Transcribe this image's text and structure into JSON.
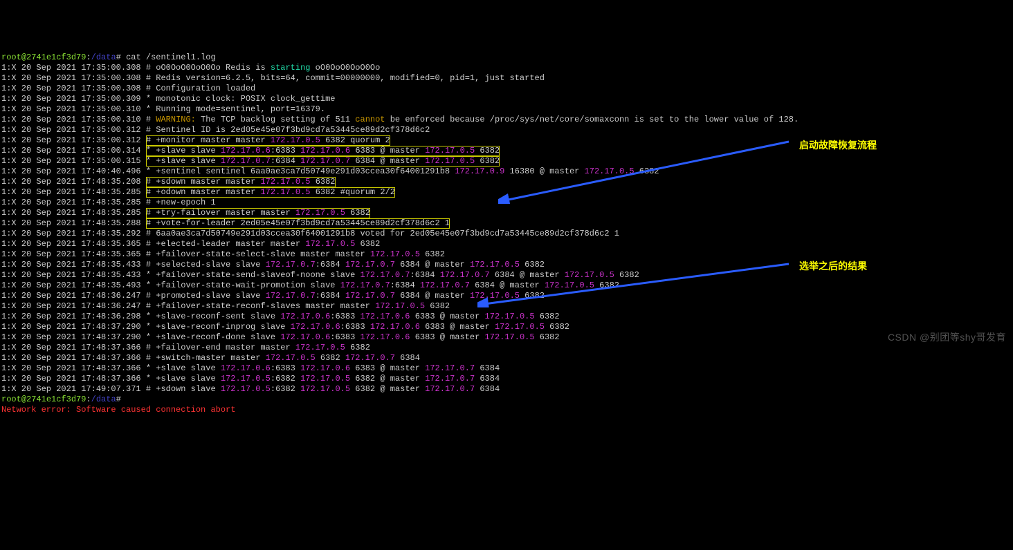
{
  "prompt": {
    "user": "root",
    "host": "2741e1cf3d79",
    "cwd": "/data",
    "sym": "#",
    "cmd": "cat /sentinel1.log"
  },
  "lines": {
    "l01a": "1:X 20 Sep 2021 17:35:00.308 # oO0OoO0OoO0Oo Redis is ",
    "l01b": "starting",
    "l01c": " oO0OoO0OoO0Oo",
    "l02": "1:X 20 Sep 2021 17:35:00.308 # Redis version=6.2.5, bits=64, commit=00000000, modified=0, pid=1, just started",
    "l03": "1:X 20 Sep 2021 17:35:00.308 # Configuration loaded",
    "l04": "1:X 20 Sep 2021 17:35:00.309 * monotonic clock: POSIX clock_gettime",
    "l05": "1:X 20 Sep 2021 17:35:00.310 * Running mode=sentinel, port=16379.",
    "l06a": "1:X 20 Sep 2021 17:35:00.310 # ",
    "l06b": "WARNING:",
    "l06c": " The TCP backlog setting of 511 ",
    "l06d": "cannot",
    "l06e": " be enforced because /proc/sys/net/core/somaxconn is set to the lower value of 128.",
    "l07": "1:X 20 Sep 2021 17:35:00.312 # Sentinel ID is 2ed05e45e07f3bd9cd7a53445ce89d2cf378d6c2",
    "l08a": "1:X 20 Sep 2021 17:35:00.312 ",
    "l08b": "# +monitor master master ",
    "l08ip": "172.17.0.5",
    "l08c": " 6382 quorum 2",
    "l09a": "1:X 20 Sep 2021 17:35:00.314 ",
    "l09b": "* +slave slave ",
    "l09ip1": "172.17.0.6",
    "l09c": ":6383 ",
    "l09ip2": "172.17.0.6",
    "l09d": " 6383 @ master ",
    "l09ip3": "172.17.0.5",
    "l09e": " 6382",
    "l10a": "1:X 20 Sep 2021 17:35:00.315 ",
    "l10b": "* +slave slave ",
    "l10ip1": "172.17.0.7",
    "l10c": ":6384 ",
    "l10ip2": "172.17.0.7",
    "l10d": " 6384 @ master ",
    "l10ip3": "172.17.0.5",
    "l10e": " 6382",
    "l11a": "1:X 20 Sep 2021 17:40:40.496 * +sentinel sentinel 6aa0ae3ca7d50749e291d03ccea30f64001291b8 ",
    "l11ip1": "172.17.0.9",
    "l11b": " 16380 @ master ",
    "l11ip2": "172.17.0.5",
    "l11c": " 6382",
    "l12a": "1:X 20 Sep 2021 17:48:35.208 ",
    "l12b": "# +sdown master master ",
    "l12ip": "172.17.0.5",
    "l12c": " 6382",
    "l13a": "1:X 20 Sep 2021 17:48:35.285 ",
    "l13b": "# +odown master master ",
    "l13ip": "172.17.0.5",
    "l13c": " 6382 #quorum 2/2",
    "l14": "1:X 20 Sep 2021 17:48:35.285 # +new-epoch 1",
    "l15a": "1:X 20 Sep 2021 17:48:35.285 ",
    "l15b": "# +try-failover master master ",
    "l15ip": "172.17.0.5",
    "l15c": " 6382",
    "l16a": "1:X 20 Sep 2021 17:48:35.288 ",
    "l16b": "# +vote-for-leader 2ed05e45e07f3bd9cd7a53445ce89d2cf378d6c2 1",
    "l17": "1:X 20 Sep 2021 17:48:35.292 # 6aa0ae3ca7d50749e291d03ccea30f64001291b8 voted for 2ed05e45e07f3bd9cd7a53445ce89d2cf378d6c2 1",
    "l18a": "1:X 20 Sep 2021 17:48:35.365 # +elected-leader master master ",
    "l18ip": "172.17.0.5",
    "l18b": " 6382",
    "l19a": "1:X 20 Sep 2021 17:48:35.365 # +failover-state-select-slave master master ",
    "l19ip": "172.17.0.5",
    "l19b": " 6382",
    "l20a": "1:X 20 Sep 2021 17:48:35.433 # +selected-slave slave ",
    "l20ip1": "172.17.0.7",
    "l20b": ":6384 ",
    "l20ip2": "172.17.0.7",
    "l20c": " 6384 @ master ",
    "l20ip3": "172.17.0.5",
    "l20d": " 6382",
    "l21a": "1:X 20 Sep 2021 17:48:35.433 * +failover-state-send-slaveof-noone slave ",
    "l21ip1": "172.17.0.7",
    "l21b": ":6384 ",
    "l21ip2": "172.17.0.7",
    "l21c": " 6384 @ master ",
    "l21ip3": "172.17.0.5",
    "l21d": " 6382",
    "l22a": "1:X 20 Sep 2021 17:48:35.493 * +failover-state-wait-promotion slave ",
    "l22ip1": "172.17.0.7",
    "l22b": ":6384 ",
    "l22ip2": "172.17.0.7",
    "l22c": " 6384 @ master ",
    "l22ip3": "172.17.0.5",
    "l22d": " 6382",
    "l23a": "1:X 20 Sep 2021 17:48:36.247 # +promoted-slave slave ",
    "l23ip1": "172.17.0.7",
    "l23b": ":6384 ",
    "l23ip2": "172.17.0.7",
    "l23c": " 6384 @ master ",
    "l23ip3": "172.17.0.5",
    "l23d": " 6382",
    "l24a": "1:X 20 Sep 2021 17:48:36.247 # +failover-state-reconf-slaves master master ",
    "l24ip": "172.17.0.5",
    "l24b": " 6382",
    "l25a": "1:X 20 Sep 2021 17:48:36.298 * +slave-reconf-sent slave ",
    "l25ip1": "172.17.0.6",
    "l25b": ":6383 ",
    "l25ip2": "172.17.0.6",
    "l25c": " 6383 @ master ",
    "l25ip3": "172.17.0.5",
    "l25d": " 6382",
    "l26a": "1:X 20 Sep 2021 17:48:37.290 * +slave-reconf-inprog slave ",
    "l26ip1": "172.17.0.6",
    "l26b": ":6383 ",
    "l26ip2": "172.17.0.6",
    "l26c": " 6383 @ master ",
    "l26ip3": "172.17.0.5",
    "l26d": " 6382",
    "l27a": "1:X 20 Sep 2021 17:48:37.290 * +slave-reconf-done slave ",
    "l27ip1": "172.17.0.6",
    "l27b": ":6383 ",
    "l27ip2": "172.17.0.6",
    "l27c": " 6383 @ master ",
    "l27ip3": "172.17.0.5",
    "l27d": " 6382",
    "l28a": "1:X 20 Sep 2021 17:48:37.366 # +failover-end master master ",
    "l28ip": "172.17.0.5",
    "l28b": " 6382",
    "l29a": "1:X 20 Sep 2021 17:48:37.366 # +switch-master master ",
    "l29ip1": "172.17.0.5",
    "l29b": " 6382 ",
    "l29ip2": "172.17.0.7",
    "l29c": " 6384",
    "l30a": "1:X 20 Sep 2021 17:48:37.366 * +slave slave ",
    "l30ip1": "172.17.0.6",
    "l30b": ":6383 ",
    "l30ip2": "172.17.0.6",
    "l30c": " 6383 @ master ",
    "l30ip3": "172.17.0.7",
    "l30d": " 6384",
    "l31a": "1:X 20 Sep 2021 17:48:37.366 * +slave slave ",
    "l31ip1": "172.17.0.5",
    "l31b": ":6382 ",
    "l31ip2": "172.17.0.5",
    "l31c": " 6382 @ master ",
    "l31ip3": "172.17.0.7",
    "l31d": " 6384",
    "l32a": "1:X 20 Sep 2021 17:49:07.371 # +sdown slave ",
    "l32ip1": "172.17.0.5",
    "l32b": ":6382 ",
    "l32ip2": "172.17.0.5",
    "l32c": " 6382 @ master ",
    "l32ip3": "172.17.0.7",
    "l32d": " 6384"
  },
  "err": "Network error: Software caused connection abort",
  "annotations": {
    "a1": "启动故障恢复流程",
    "a2": "选举之后的结果"
  },
  "watermark": "CSDN @别团等shy哥发育"
}
